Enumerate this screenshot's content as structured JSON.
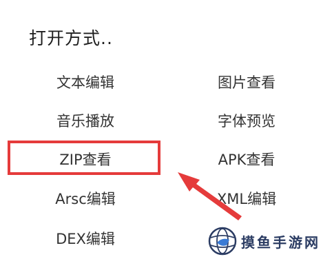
{
  "dialog": {
    "title": "打开方式..",
    "options_left": [
      "文本编辑",
      "音乐播放",
      "ZIP查看",
      "Arsc编辑",
      "DEX编辑"
    ],
    "options_right": [
      "图片查看",
      "字体预览",
      "APK查看",
      "XML编辑"
    ],
    "highlighted_option": "ZIP查看"
  },
  "annotation": {
    "highlight_color": "#e53b3b",
    "arrow_color": "#e53b3b",
    "arrow_target": "ZIP查看"
  },
  "watermark": {
    "text": "摸鱼手游网",
    "logo_icon": "globe-logo-icon",
    "color": "#2b3c63"
  }
}
